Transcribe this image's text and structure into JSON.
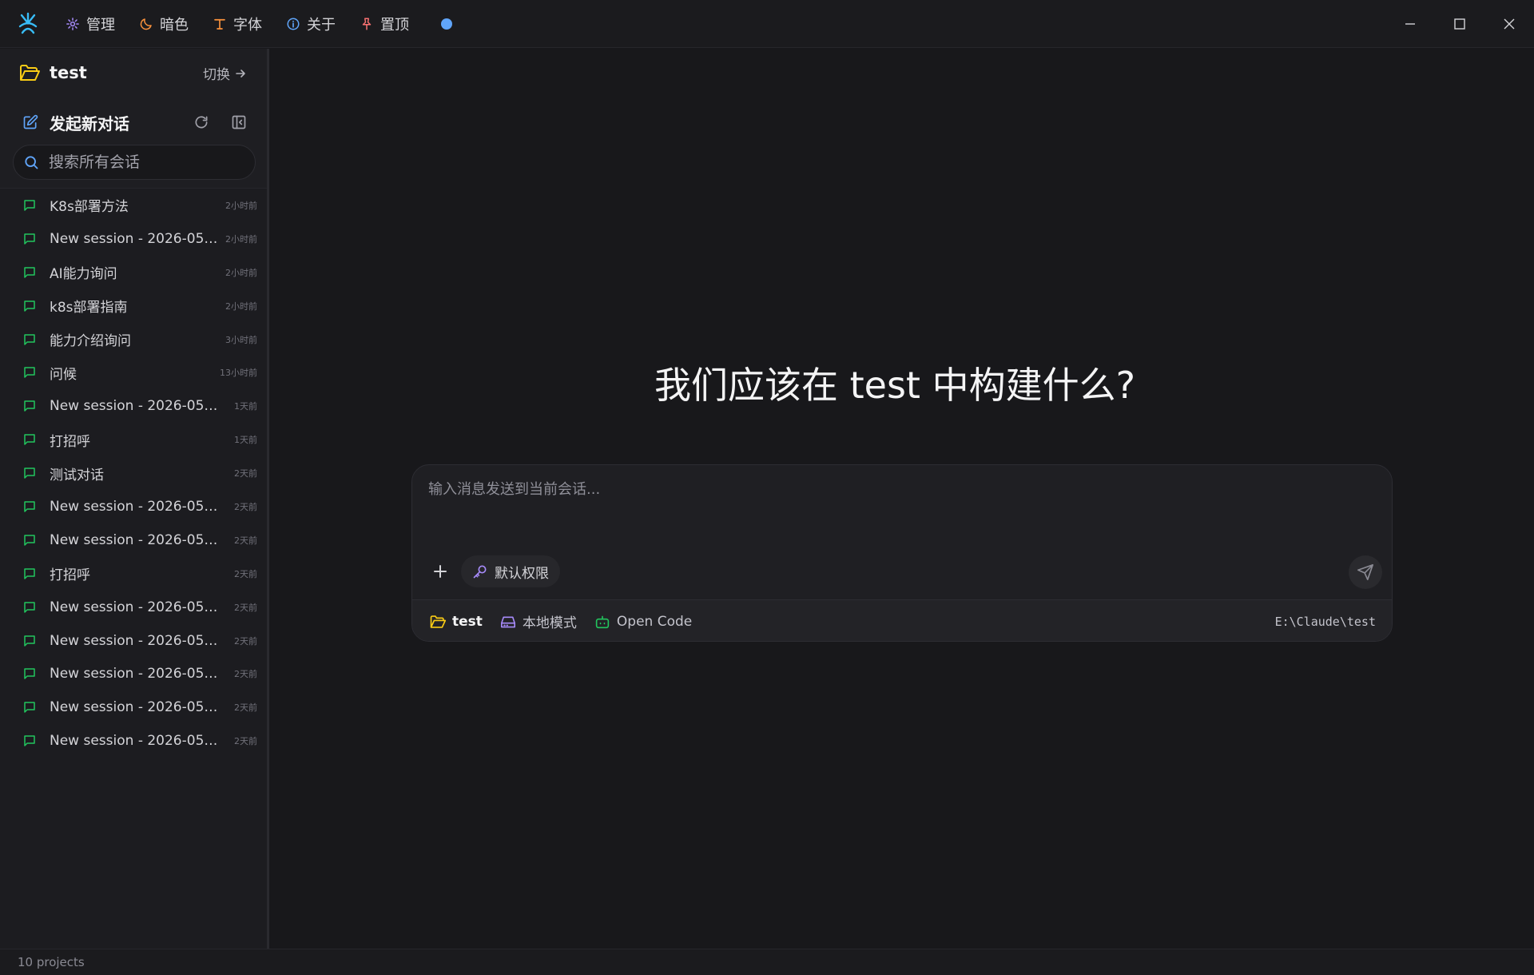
{
  "titlebar": {
    "menu": [
      {
        "label": "管理",
        "icon": "gear-icon",
        "color": "#a78bfa"
      },
      {
        "label": "暗色",
        "icon": "moon-icon",
        "color": "#fb923c"
      },
      {
        "label": "字体",
        "icon": "type-icon",
        "color": "#fb923c"
      },
      {
        "label": "关于",
        "icon": "info-icon",
        "color": "#60a5fa"
      },
      {
        "label": "置顶",
        "icon": "pin-icon",
        "color": "#f87171"
      }
    ],
    "status_dot_color": "#60a5fa"
  },
  "sidebar": {
    "project_name": "test",
    "switch_label": "切换",
    "new_chat_label": "发起新对话",
    "search_placeholder": "搜索所有会话",
    "sessions": [
      {
        "title": "K8s部署方法",
        "time": "2小时前"
      },
      {
        "title": "New session - 2026-05-...",
        "time": "2小时前"
      },
      {
        "title": "AI能力询问",
        "time": "2小时前"
      },
      {
        "title": "k8s部署指南",
        "time": "2小时前"
      },
      {
        "title": "能力介绍询问",
        "time": "3小时前"
      },
      {
        "title": "问候",
        "time": "13小时前"
      },
      {
        "title": "New session - 2026-05-2...",
        "time": "1天前"
      },
      {
        "title": "打招呼",
        "time": "1天前"
      },
      {
        "title": "测试对话",
        "time": "2天前"
      },
      {
        "title": "New session - 2026-05-2...",
        "time": "2天前"
      },
      {
        "title": "New session - 2026-05-2...",
        "time": "2天前"
      },
      {
        "title": "打招呼",
        "time": "2天前"
      },
      {
        "title": "New session - 2026-05-2...",
        "time": "2天前"
      },
      {
        "title": "New session - 2026-05-2...",
        "time": "2天前"
      },
      {
        "title": "New session - 2026-05-2...",
        "time": "2天前"
      },
      {
        "title": "New session - 2026-05-2...",
        "time": "2天前"
      },
      {
        "title": "New session - 2026-05-2...",
        "time": "2天前"
      }
    ],
    "footer": "10 projects"
  },
  "main": {
    "heading": "我们应该在 test 中构建什么?",
    "composer": {
      "placeholder": "输入消息发送到当前会话...",
      "permission_label": "默认权限",
      "project": "test",
      "mode": "本地模式",
      "agent": "Open Code",
      "path": "E:\\Claude\\test"
    }
  },
  "colors": {
    "accent_green": "#22c55e",
    "folder_yellow": "#facc15",
    "new_chat_blue": "#60a5fa"
  }
}
